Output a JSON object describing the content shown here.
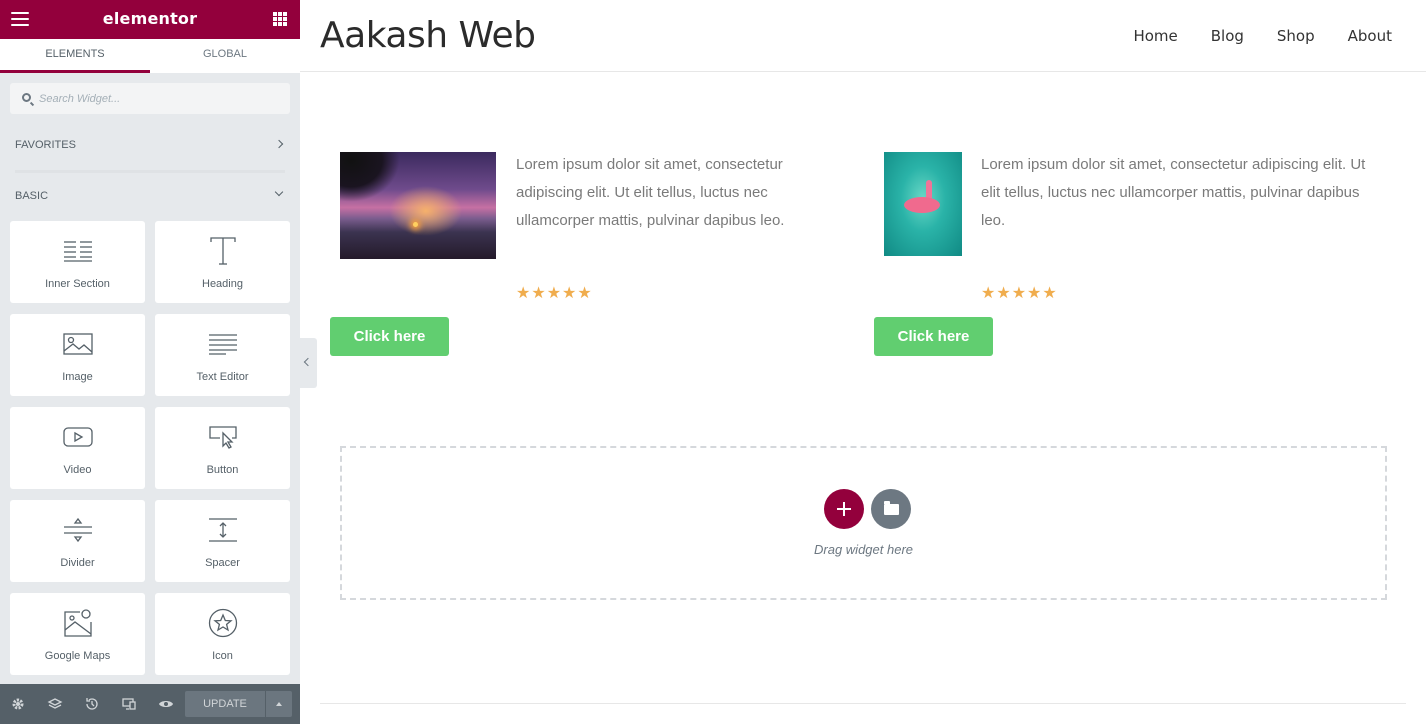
{
  "editor": {
    "brand": "elementor",
    "tabs": [
      {
        "label": "ELEMENTS",
        "active": true
      },
      {
        "label": "GLOBAL",
        "active": false
      }
    ],
    "search": {
      "placeholder": "Search Widget..."
    },
    "categories": {
      "favorites": "FAVORITES",
      "basic": "BASIC"
    },
    "widgets": [
      {
        "label": "Inner Section",
        "icon": "inner-section-icon"
      },
      {
        "label": "Heading",
        "icon": "heading-icon"
      },
      {
        "label": "Image",
        "icon": "image-icon"
      },
      {
        "label": "Text Editor",
        "icon": "text-editor-icon"
      },
      {
        "label": "Video",
        "icon": "video-icon"
      },
      {
        "label": "Button",
        "icon": "button-icon"
      },
      {
        "label": "Divider",
        "icon": "divider-icon"
      },
      {
        "label": "Spacer",
        "icon": "spacer-icon"
      },
      {
        "label": "Google Maps",
        "icon": "google-maps-icon"
      },
      {
        "label": "Icon",
        "icon": "icon-widget-icon"
      }
    ],
    "footer": {
      "update_label": "UPDATE",
      "icons": [
        "settings-icon",
        "navigator-icon",
        "history-icon",
        "responsive-icon",
        "preview-icon"
      ]
    },
    "colors": {
      "brand": "#93003c",
      "sidebar_bg": "#e6e9ec",
      "footer_bg": "#556068"
    }
  },
  "site": {
    "title": "Aakash Web",
    "nav": [
      "Home",
      "Blog",
      "Shop",
      "About"
    ]
  },
  "content": {
    "columns": [
      {
        "image": "sunset-beach-image",
        "text": "Lorem ipsum dolor sit amet, consectetur adipiscing elit. Ut elit tellus, luctus nec ullamcorper mattis, pulvinar dapibus leo.",
        "rating": 5,
        "button": "Click here"
      },
      {
        "image": "flamingo-float-image",
        "text": "Lorem ipsum dolor sit amet, consectetur adipiscing elit. Ut elit tellus, luctus nec ullamcorper mattis, pulvinar dapibus leo.",
        "rating": 5,
        "button": "Click here"
      }
    ],
    "dropzone": {
      "text": "Drag widget here"
    },
    "colors": {
      "button": "#61ce70",
      "stars": "#f0ad4e"
    }
  }
}
